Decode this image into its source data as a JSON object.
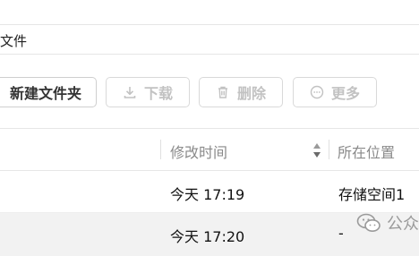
{
  "title_row": {
    "title": "文件"
  },
  "toolbar": {
    "new_folder_label": "新建文件夹",
    "download_label": "下载",
    "delete_label": "删除",
    "more_label": "更多"
  },
  "table": {
    "columns": {
      "modified": "修改时间",
      "location": "所在位置"
    },
    "rows": [
      {
        "modified": "今天 17:19",
        "location": "存储空间1"
      },
      {
        "modified": "今天 17:20",
        "location": "-"
      }
    ]
  },
  "watermark": {
    "text": "公众",
    "icon": "wechat-icon"
  },
  "colors": {
    "disabled_text": "#c2c2c2",
    "row_highlight": "#f2f2f2",
    "border": "#e6e6e6"
  }
}
